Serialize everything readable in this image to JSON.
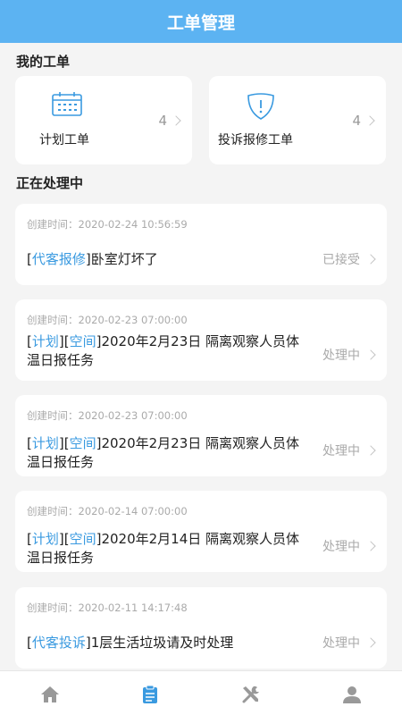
{
  "header": {
    "title": "工单管理"
  },
  "sections": {
    "my_orders": "我的工单",
    "in_progress": "正在处理中"
  },
  "summary": [
    {
      "label": "计划工单",
      "count": "4",
      "icon": "calendar-icon"
    },
    {
      "label": "投诉报修工单",
      "count": "4",
      "icon": "shield-alert-icon"
    }
  ],
  "orders": [
    {
      "time": "创建时间：2020-02-24 10:56:59",
      "tags": [
        "代客报修"
      ],
      "text": "卧室灯坏了",
      "status": "已接受"
    },
    {
      "time": "创建时间：2020-02-23 07:00:00",
      "tags": [
        "计划",
        "空间"
      ],
      "text": "2020年2月23日 隔离观察人员体温日报任务",
      "status": "处理中"
    },
    {
      "time": "创建时间：2020-02-23 07:00:00",
      "tags": [
        "计划",
        "空间"
      ],
      "text": "2020年2月23日 隔离观察人员体温日报任务",
      "status": "处理中"
    },
    {
      "time": "创建时间：2020-02-14 07:00:00",
      "tags": [
        "计划",
        "空间"
      ],
      "text": "2020年2月14日 隔离观察人员体温日报任务",
      "status": "处理中"
    },
    {
      "time": "创建时间：2020-02-11 14:17:48",
      "tags": [
        "代客投诉"
      ],
      "text": "1层生活垃圾请及时处理",
      "status": "处理中"
    }
  ],
  "tabbar": {
    "items": [
      {
        "icon": "home-icon",
        "active": false
      },
      {
        "icon": "clipboard-icon",
        "active": true
      },
      {
        "icon": "tools-icon",
        "active": false
      },
      {
        "icon": "user-icon",
        "active": false
      }
    ],
    "active_color": "#3a9ae0",
    "inactive_color": "#999999"
  },
  "colors": {
    "header": "#5cb3f2",
    "accent": "#3a9ae0"
  }
}
